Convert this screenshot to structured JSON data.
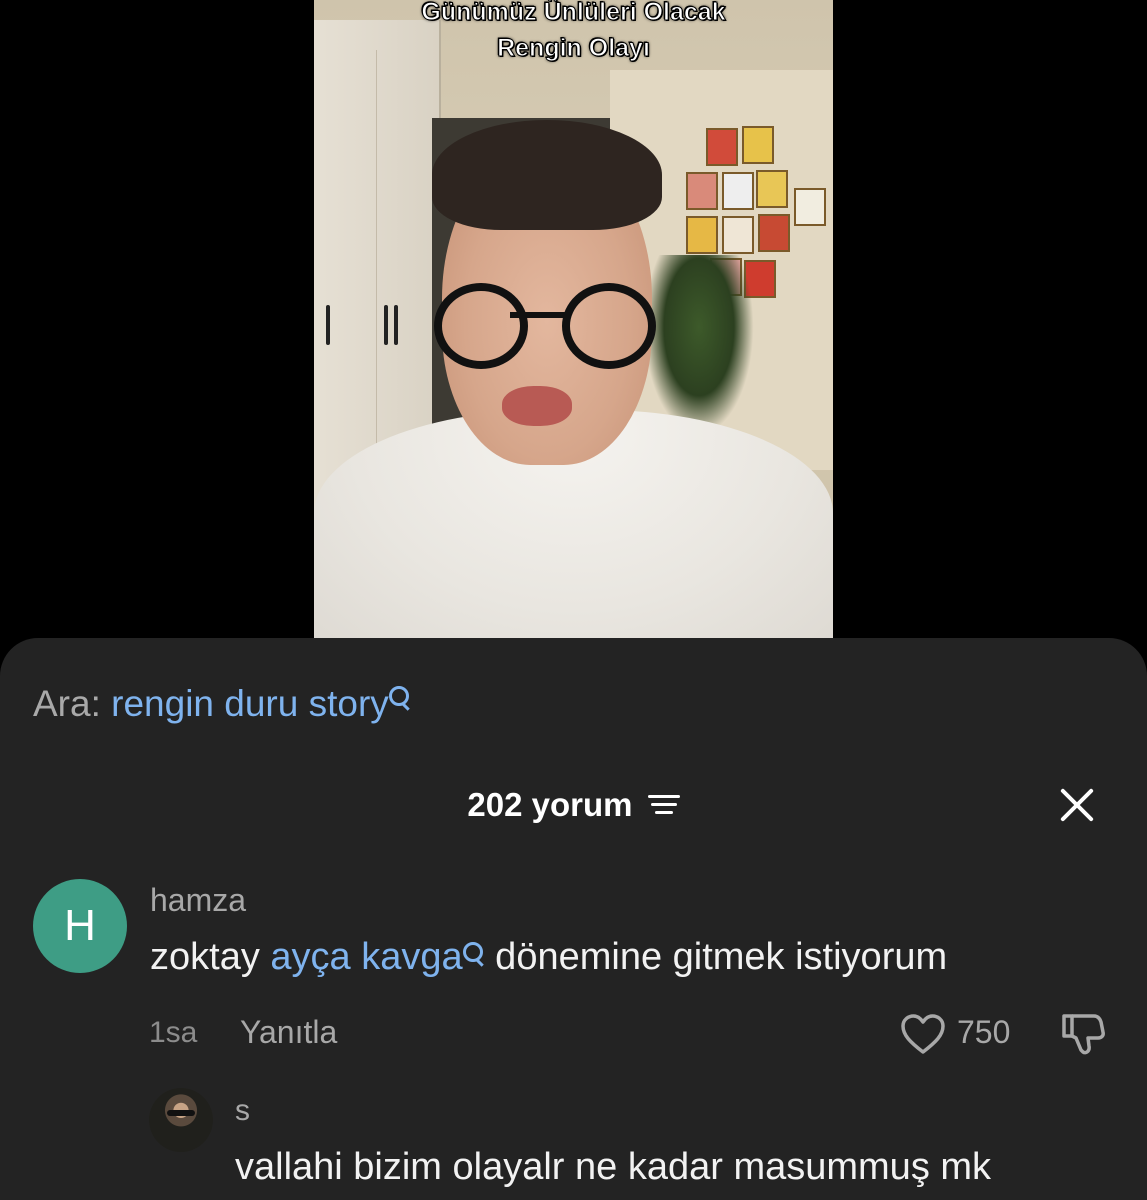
{
  "video": {
    "caption_line1": "Günümüz Ünlüleri Olacak",
    "caption_line2": "Rengin Olayı"
  },
  "search_suggestion": {
    "prefix": "Ara:",
    "term": "rengin duru story"
  },
  "comments_header": {
    "count_label": "202 yorum",
    "sort_icon": "sort-lines-icon",
    "close_icon": "close-icon"
  },
  "comments": [
    {
      "avatar_letter": "H",
      "avatar_color": "#3e9d85",
      "username": "hamza",
      "text_before": "zoktay ",
      "link_text": "ayça kavga",
      "text_after": " dönemine gitmek istiyorum",
      "time": "1sa",
      "reply_label": "Yanıtla",
      "like_count": "750"
    }
  ],
  "reply": {
    "username": "s",
    "text": "vallahi bizim olayalr ne kadar masummuş mk"
  },
  "colors": {
    "sheet_bg": "#232323",
    "link": "#7fb3ee",
    "muted": "#a8a8a8"
  }
}
